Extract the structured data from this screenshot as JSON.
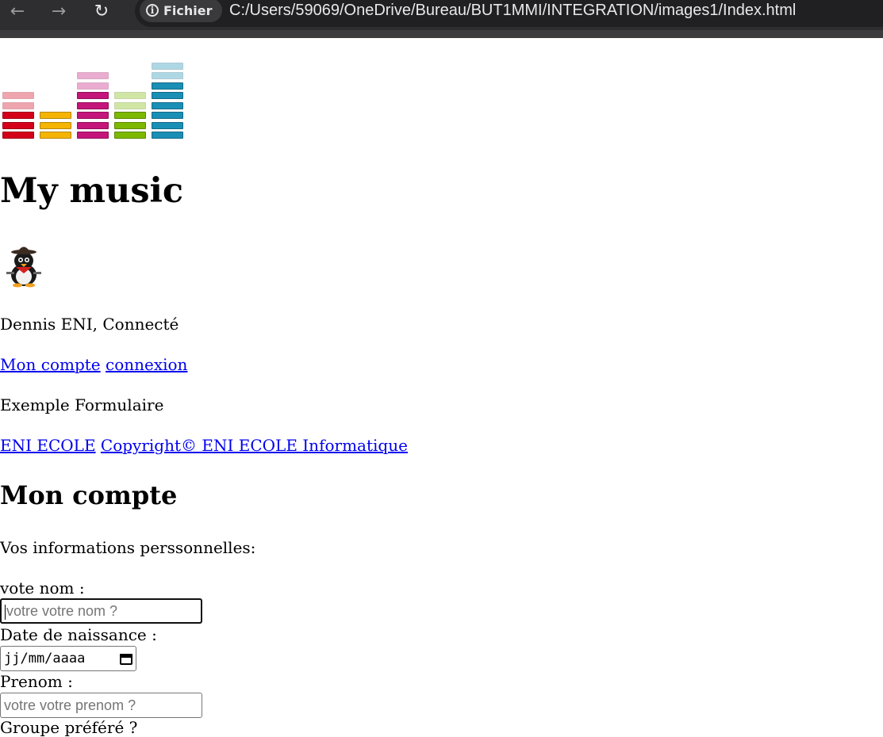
{
  "browser": {
    "site_label": "Fichier",
    "url": "C:/Users/59069/OneDrive/Bureau/BUT1MMI/INTEGRATION/images1/Index.html",
    "back_icon": "arrow-left-icon",
    "forward_icon": "arrow-right-icon",
    "reload_icon": "reload-icon",
    "info_icon": "info-icon"
  },
  "header": {
    "logo_colors": [
      "#d4001a",
      "#f4b400",
      "#c4157a",
      "#7cb800",
      "#1a8fb5"
    ],
    "title": "My music"
  },
  "user": {
    "status": "Dennis ENI, Connecté",
    "links": [
      "Mon compte",
      "connexion"
    ]
  },
  "example": {
    "label": "Exemple Formulaire"
  },
  "footer": {
    "school_link": "ENI ECOLE",
    "copyright_link": "Copyright© ENI ECOLE Informatique"
  },
  "account": {
    "heading": "Mon compte",
    "intro": "Vos informations perssonnelles:",
    "nom_label": "vote nom :",
    "nom_placeholder": "votre votre nom ?",
    "birth_label": "Date de naissance :",
    "birth_placeholder": "jj/mm/aaaa",
    "prenom_label": "Prenom :",
    "prenom_placeholder": "votre votre prenom ?",
    "group_label": "Groupe préféré ?"
  }
}
